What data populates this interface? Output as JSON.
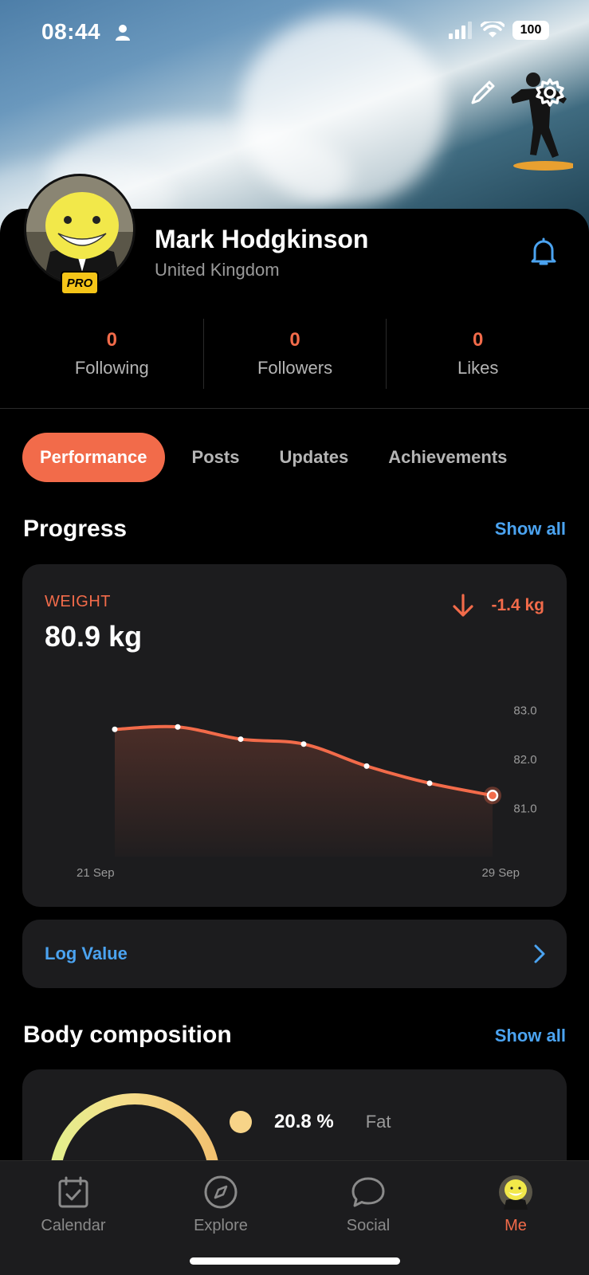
{
  "status_bar": {
    "time": "08:44",
    "battery": "100"
  },
  "profile": {
    "name": "Mark Hodgkinson",
    "country": "United Kingdom",
    "badge": "PRO"
  },
  "stats": [
    {
      "value": "0",
      "label": "Following"
    },
    {
      "value": "0",
      "label": "Followers"
    },
    {
      "value": "0",
      "label": "Likes"
    }
  ],
  "tabs": [
    {
      "label": "Performance",
      "active": true
    },
    {
      "label": "Posts"
    },
    {
      "label": "Updates"
    },
    {
      "label": "Achievements"
    }
  ],
  "progress": {
    "title": "Progress",
    "show_all": "Show all",
    "weight": {
      "label": "WEIGHT",
      "value": "80.9 kg",
      "change": "-1.4 kg"
    },
    "log_value": "Log Value"
  },
  "chart_data": {
    "type": "area",
    "x_labels": [
      "21 Sep",
      "29 Sep"
    ],
    "x": [
      1,
      2,
      3,
      4,
      5,
      6,
      7
    ],
    "values": [
      82.6,
      82.65,
      82.4,
      82.3,
      81.85,
      81.5,
      81.25
    ],
    "yticks": [
      "83.0",
      "82.0",
      "81.0"
    ],
    "ylim": [
      80.0,
      83.5
    ],
    "color": "#f26b4a"
  },
  "body_composition": {
    "title": "Body composition",
    "show_all": "Show all",
    "fat_value": "20.8 %",
    "fat_label": "Fat"
  },
  "nav": [
    {
      "label": "Calendar",
      "icon": "calendar-icon"
    },
    {
      "label": "Explore",
      "icon": "compass-icon"
    },
    {
      "label": "Social",
      "icon": "chat-bubble-icon"
    },
    {
      "label": "Me",
      "icon": "avatar-icon",
      "active": true
    }
  ],
  "colors": {
    "accent": "#f26b4a",
    "link": "#4ba3f0",
    "card": "#1c1c1e"
  }
}
